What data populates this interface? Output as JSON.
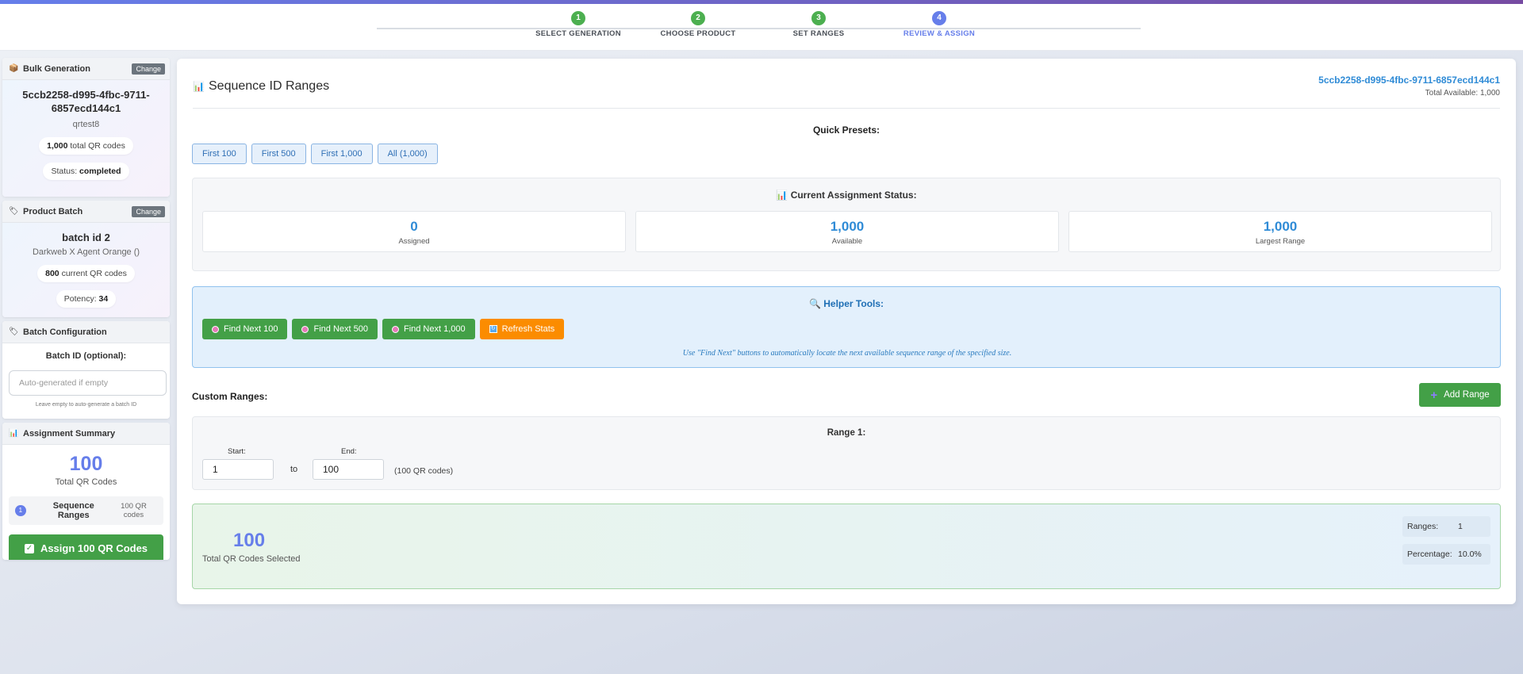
{
  "stepper": {
    "steps": [
      {
        "num": "1",
        "label": "SELECT GENERATION"
      },
      {
        "num": "2",
        "label": "CHOOSE PRODUCT"
      },
      {
        "num": "3",
        "label": "SET RANGES"
      },
      {
        "num": "4",
        "label": "REVIEW & ASSIGN"
      }
    ]
  },
  "sidebar": {
    "bulk": {
      "title": "Bulk Generation",
      "change": "Change",
      "id": "5ccb2258-d995-4fbc-9711-6857ecd144c1",
      "name": "qrtest8",
      "total_num": "1,000",
      "total_text": "total QR codes",
      "status_label": "Status:",
      "status_value": "completed"
    },
    "product": {
      "title": "Product Batch",
      "change": "Change",
      "batch": "batch id 2",
      "product": "Darkweb X Agent Orange ()",
      "current_num": "800",
      "current_text": "current QR codes",
      "potency_label": "Potency:",
      "potency_value": "34"
    },
    "config": {
      "title": "Batch Configuration",
      "label": "Batch ID (optional):",
      "placeholder": "Auto-generated if empty",
      "hint": "Leave empty to auto-generate a batch ID"
    },
    "summary": {
      "title": "Assignment Summary",
      "total": "100",
      "total_label": "Total QR Codes",
      "range_index": "1",
      "range_label": "Sequence Ranges",
      "range_count": "100 QR codes",
      "assign_button": "Assign 100 QR Codes"
    }
  },
  "main": {
    "title": "Sequence ID Ranges",
    "gen_id": "5ccb2258-d995-4fbc-9711-6857ecd144c1",
    "total_available": "Total Available: 1,000",
    "presets_title": "Quick Presets:",
    "presets": [
      "First 100",
      "First 500",
      "First 1,000",
      "All (1,000)"
    ],
    "status": {
      "title": "Current Assignment Status:",
      "stats": [
        {
          "value": "0",
          "label": "Assigned"
        },
        {
          "value": "1,000",
          "label": "Available"
        },
        {
          "value": "1,000",
          "label": "Largest Range"
        }
      ]
    },
    "helper": {
      "title": "Helper Tools:",
      "buttons": [
        "Find Next 100",
        "Find Next 500",
        "Find Next 1,000",
        "Refresh Stats"
      ],
      "note": "Use \"Find Next\" buttons to automatically locate the next available sequence range of the specified size."
    },
    "custom": {
      "title": "Custom Ranges:",
      "add_button": "Add Range",
      "range": {
        "title": "Range 1:",
        "start_label": "Start:",
        "start_value": "1",
        "to": "to",
        "end_label": "End:",
        "end_value": "100",
        "codes": "(100 QR codes)"
      }
    },
    "selected": {
      "total": "100",
      "label": "Total QR Codes Selected",
      "ranges_label": "Ranges:",
      "ranges_value": "1",
      "percentage_label": "Percentage:",
      "percentage_value": "10.0%"
    }
  },
  "colors": {
    "accent": "#667eea",
    "success": "#43a047",
    "warning": "#fb8c00",
    "link": "#2f8bd6"
  }
}
